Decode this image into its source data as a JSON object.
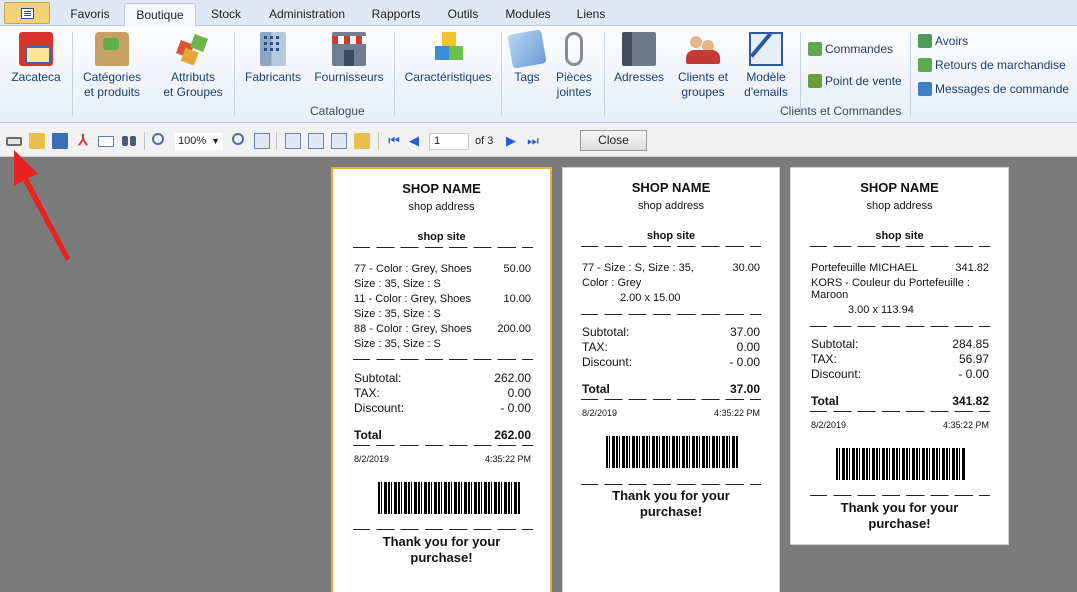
{
  "tabs": [
    "Favoris",
    "Boutique",
    "Stock",
    "Administration",
    "Rapports",
    "Outils",
    "Modules",
    "Liens"
  ],
  "active_tab": "Boutique",
  "ribbon": {
    "zacateca": "Zacateca",
    "categories": [
      "Catégories",
      "et produits"
    ],
    "attributs": [
      "Attributs",
      "et Groupes"
    ],
    "fabricants": "Fabricants",
    "fournisseurs": "Fournisseurs",
    "caracteristiques": "Caractéristiques",
    "tags": "Tags",
    "pieces": [
      "Pièces",
      "jointes"
    ],
    "adresses": "Adresses",
    "clients": [
      "Clients et",
      "groupes"
    ],
    "modele": [
      "Modèle",
      "d'emails"
    ],
    "commandes": "Commandes",
    "point_de_vente": "Point de vente",
    "avoirs": "Avoirs",
    "retours": "Retours de marchandise",
    "messages": "Messages de commande",
    "group_catalogue": "Catalogue",
    "group_clients": "Clients et Commandes"
  },
  "toolbar": {
    "zoom": "100%",
    "page": "1",
    "of": "of 3",
    "close": "Close"
  },
  "receipts": [
    {
      "shop_name": "SHOP NAME",
      "shop_address": "shop address",
      "shop_site": "shop site",
      "items": [
        {
          "desc": "77 - Color : Grey, Shoes",
          "amount": "50.00"
        },
        {
          "desc": "Size : 35, Size : S",
          "amount": ""
        },
        {
          "desc": "11 - Color : Grey, Shoes",
          "amount": "10.00"
        },
        {
          "desc": "Size : 35, Size : S",
          "amount": ""
        },
        {
          "desc": "88 - Color : Grey, Shoes",
          "amount": "200.00"
        },
        {
          "desc": "Size : 35, Size : S",
          "amount": ""
        }
      ],
      "subtotal_label": "Subtotal:",
      "subtotal": "262.00",
      "tax_label": "TAX:",
      "tax": "0.00",
      "discount_label": "Discount:",
      "discount": "- 0.00",
      "total_label": "Total",
      "total": "262.00",
      "date": "8/2/2019",
      "time": "4:35:22 PM",
      "thanks": [
        "Thank you for your",
        "purchase!"
      ]
    },
    {
      "shop_name": "SHOP NAME",
      "shop_address": "shop address",
      "shop_site": "shop site",
      "items": [
        {
          "desc": "77 - Size : S, Size : 35,",
          "amount": "30.00"
        },
        {
          "desc": "Color : Grey",
          "amount": ""
        },
        {
          "desc": "2.00 x 15.00",
          "amount": ""
        }
      ],
      "subtotal_label": "Subtotal:",
      "subtotal": "37.00",
      "tax_label": "TAX:",
      "tax": "0.00",
      "discount_label": "Discount:",
      "discount": "- 0.00",
      "total_label": "Total",
      "total": "37.00",
      "date": "8/2/2019",
      "time": "4:35:22 PM",
      "thanks": [
        "Thank you for your",
        "purchase!"
      ]
    },
    {
      "shop_name": "SHOP NAME",
      "shop_address": "shop address",
      "shop_site": "shop site",
      "items": [
        {
          "desc": "Portefeuille MICHAEL",
          "amount": "341.82"
        },
        {
          "desc": "KORS - Couleur du Portefeuille :",
          "amount": ""
        },
        {
          "desc": "Maroon",
          "amount": ""
        },
        {
          "desc": "3.00 x 113.94",
          "amount": ""
        }
      ],
      "subtotal_label": "Subtotal:",
      "subtotal": "284.85",
      "tax_label": "TAX:",
      "tax": "56.97",
      "discount_label": "Discount:",
      "discount": "- 0.00",
      "total_label": "Total",
      "total": "341.82",
      "date": "8/2/2019",
      "time": "4:35:22 PM",
      "thanks": [
        "Thank you for your",
        "purchase!"
      ]
    }
  ]
}
